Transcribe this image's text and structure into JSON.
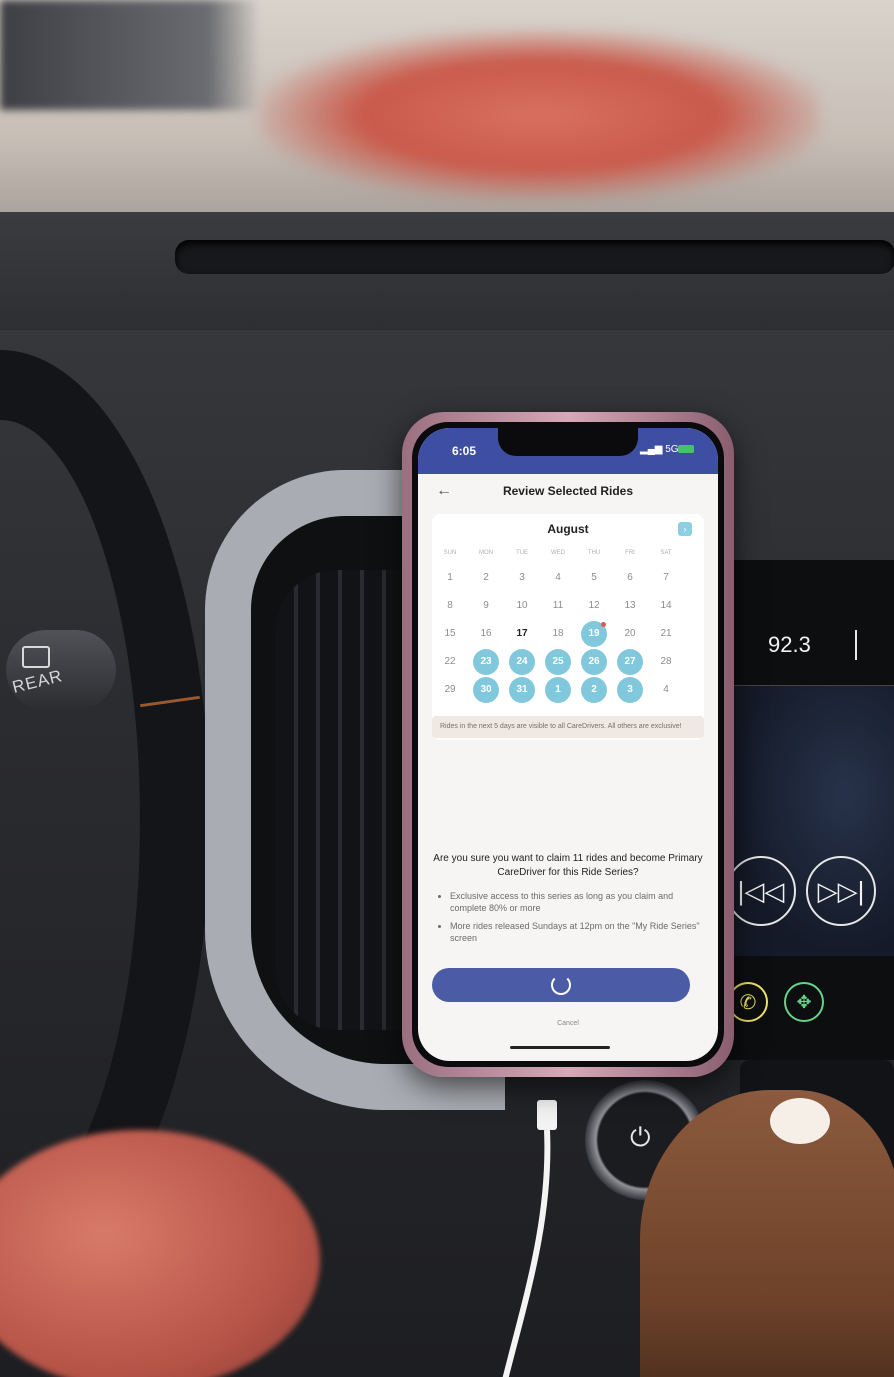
{
  "car": {
    "stalk_label": "REAR",
    "radio_frequency": "92.3",
    "prev_icon": "prev-track-icon",
    "next_icon": "next-track-icon",
    "phone_icon": "phone-icon",
    "nav_icon": "navigation-icon",
    "power_icon": "power-icon"
  },
  "phone": {
    "status": {
      "time": "6:05",
      "network": "5G"
    },
    "header": {
      "back_icon": "back-arrow-icon",
      "title": "Review Selected Rides"
    },
    "calendar": {
      "month": "August",
      "next_icon": "chevron-right-icon",
      "weekdays": [
        "SUN",
        "MON",
        "TUE",
        "WED",
        "THU",
        "FRI",
        "SAT"
      ],
      "weeks": [
        [
          "1",
          "2",
          "3",
          "4",
          "5",
          "6",
          "7"
        ],
        [
          "8",
          "9",
          "10",
          "11",
          "12",
          "13",
          "14"
        ],
        [
          "15",
          "16",
          "17",
          "18",
          "19",
          "20",
          "21"
        ],
        [
          "22",
          "23",
          "24",
          "25",
          "26",
          "27",
          "28"
        ],
        [
          "29",
          "30",
          "31",
          "1",
          "2",
          "3",
          "4"
        ]
      ],
      "today": "17",
      "selected": [
        "19",
        "23",
        "24",
        "25",
        "26",
        "27",
        "30",
        "31",
        "1",
        "2",
        "3"
      ]
    },
    "note": "Rides in the next 5 days are visible to all CareDrivers. All others are exclusive!",
    "question": "Are you sure you want to claim 11 rides and become Primary CareDriver for this Ride Series?",
    "bullets": [
      "Exclusive access to this series as long as you claim and complete 80% or more",
      "More rides released Sundays at 12pm on the \"My Ride Series\" screen"
    ],
    "cancel_label": "Cancel"
  },
  "colors": {
    "brand": "#3e4fa3",
    "button": "#4b5ba6",
    "selected_day": "#82c8dc",
    "accent_dot": "#e2574c"
  }
}
